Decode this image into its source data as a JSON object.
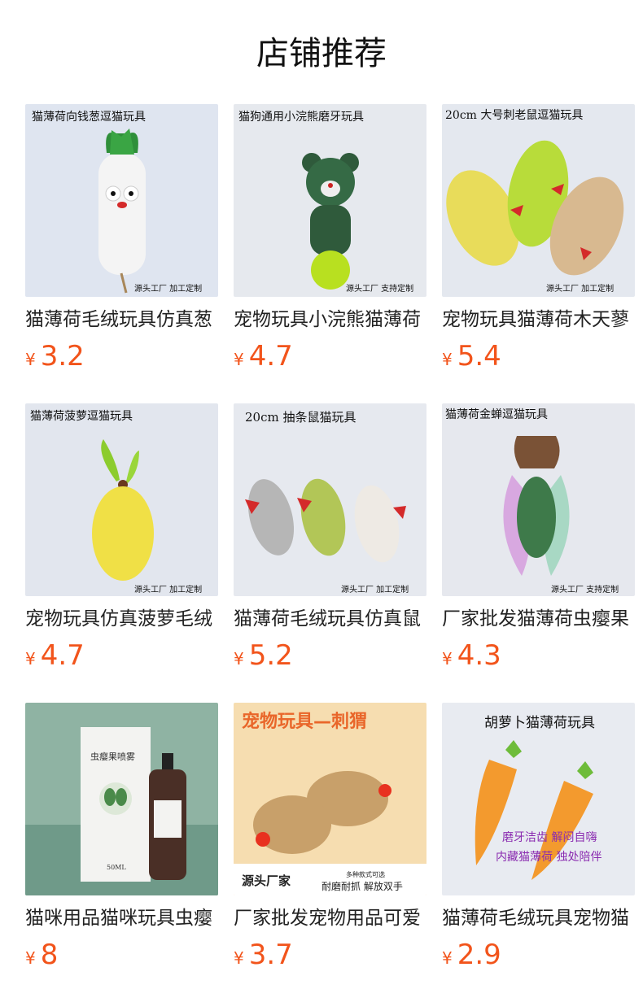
{
  "page": {
    "title": "店铺推荐"
  },
  "products": [
    {
      "image_caption": "猫薄荷向钱葱逗猫玩具",
      "image_footer": "源头工厂 加工定制",
      "title": "猫薄荷毛绒玩具仿真葱",
      "currency": "¥",
      "price": "3.2"
    },
    {
      "image_caption": "猫狗通用小浣熊磨牙玩具",
      "image_footer": "源头工厂 支持定制",
      "title": "宠物玩具小浣熊猫薄荷",
      "currency": "¥",
      "price": "4.7"
    },
    {
      "image_caption": "20cm 大号刺老鼠逗猫玩具",
      "image_footer": "源头工厂 加工定制",
      "title": "宠物玩具猫薄荷木天蓼",
      "currency": "¥",
      "price": "5.4"
    },
    {
      "image_caption": "猫薄荷菠萝逗猫玩具",
      "image_footer": "源头工厂 加工定制",
      "title": "宠物玩具仿真菠萝毛绒",
      "currency": "¥",
      "price": "4.7"
    },
    {
      "image_caption": "20cm 抽条鼠猫玩具",
      "image_footer": "源头工厂 加工定制",
      "title": "猫薄荷毛绒玩具仿真鼠",
      "currency": "¥",
      "price": "5.2"
    },
    {
      "image_caption": "猫薄荷金蝉逗猫玩具",
      "image_footer": "源头工厂 支持定制",
      "title": "厂家批发猫薄荷虫瘿果",
      "currency": "¥",
      "price": "4.3"
    },
    {
      "image_caption": "虫瘿果喷雾",
      "image_footer": "50ML",
      "title": "猫咪用品猫咪玩具虫瘿",
      "currency": "¥",
      "price": "8"
    },
    {
      "image_caption": "宠物玩具—刺猬",
      "image_footer": "源头厂家",
      "image_sub_1": "多种款式可选",
      "image_sub_2": "耐磨耐抓 解放双手",
      "title": "厂家批发宠物用品可爱",
      "currency": "¥",
      "price": "3.7"
    },
    {
      "image_caption": "胡萝卜猫薄荷玩具",
      "image_sub_1": "磨牙洁齿 解闷自嗨",
      "image_sub_2": "内藏猫薄荷 独处陪伴",
      "title": "猫薄荷毛绒玩具宠物猫",
      "currency": "¥",
      "price": "2.9"
    }
  ],
  "colors": {
    "price": "#f2541b",
    "title": "#111111"
  }
}
